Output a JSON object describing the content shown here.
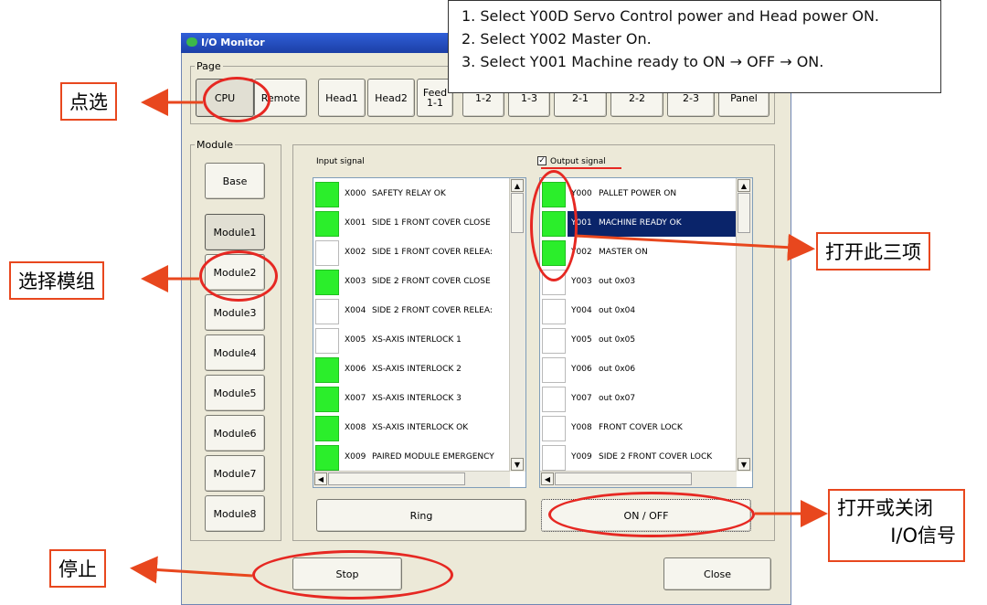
{
  "window": {
    "title": "I/O Monitor"
  },
  "page_group": {
    "label": "Page",
    "buttons": [
      "CPU",
      "Remote",
      "Head1",
      "Head2",
      "Feed\n1-1",
      "1-2",
      "1-3",
      "2-1",
      "2-2",
      "2-3",
      "Panel"
    ]
  },
  "module_group": {
    "label": "Module",
    "buttons": [
      "Base",
      "Module1",
      "Module2",
      "Module3",
      "Module4",
      "Module5",
      "Module6",
      "Module7",
      "Module8"
    ]
  },
  "input_panel": {
    "label": "Input signal",
    "rows": [
      {
        "code": "X000",
        "name": "SAFETY RELAY OK",
        "on": true
      },
      {
        "code": "X001",
        "name": "SIDE 1 FRONT COVER CLOSE",
        "on": true
      },
      {
        "code": "X002",
        "name": "SIDE 1 FRONT COVER RELEA:",
        "on": false
      },
      {
        "code": "X003",
        "name": "SIDE 2 FRONT COVER CLOSE",
        "on": true
      },
      {
        "code": "X004",
        "name": "SIDE 2 FRONT COVER RELEA:",
        "on": false
      },
      {
        "code": "X005",
        "name": "XS-AXIS INTERLOCK 1",
        "on": false
      },
      {
        "code": "X006",
        "name": "XS-AXIS INTERLOCK 2",
        "on": true
      },
      {
        "code": "X007",
        "name": "XS-AXIS INTERLOCK 3",
        "on": true
      },
      {
        "code": "X008",
        "name": "XS-AXIS INTERLOCK OK",
        "on": true
      },
      {
        "code": "X009",
        "name": "PAIRED MODULE EMERGENCY",
        "on": true
      }
    ]
  },
  "output_panel": {
    "label": "Output signal",
    "checked": true,
    "rows": [
      {
        "code": "Y000",
        "name": "PALLET POWER ON",
        "on": true
      },
      {
        "code": "Y001",
        "name": "MACHINE READY OK",
        "on": true,
        "selected": true
      },
      {
        "code": "Y002",
        "name": "MASTER ON",
        "on": true
      },
      {
        "code": "Y003",
        "name": "out 0x03",
        "on": false
      },
      {
        "code": "Y004",
        "name": "out 0x04",
        "on": false
      },
      {
        "code": "Y005",
        "name": "out 0x05",
        "on": false
      },
      {
        "code": "Y006",
        "name": "out 0x06",
        "on": false
      },
      {
        "code": "Y007",
        "name": "out 0x07",
        "on": false
      },
      {
        "code": "Y008",
        "name": "FRONT COVER LOCK",
        "on": false
      },
      {
        "code": "Y009",
        "name": "SIDE 2 FRONT COVER LOCK",
        "on": false
      }
    ]
  },
  "buttons": {
    "ring": "Ring",
    "onoff": "ON / OFF",
    "stop": "Stop",
    "close": "Close"
  },
  "instructions": [
    "1. Select Y00D Servo Control power and Head power ON.",
    "2. Select Y002 Master On.",
    "3. Select Y001 Machine ready to ON → OFF → ON."
  ],
  "callouts": {
    "click": "点选",
    "select_module": "选择模组",
    "open_three": "打开此三项",
    "toggle_io_line1": "打开或关闭",
    "toggle_io_line2": "I/O信号",
    "stop": "停止"
  },
  "colors": {
    "signal_on": "#2bee2b",
    "selection": "#0a246a",
    "annotation": "#e62822",
    "titlebar": "#2f5fd8"
  }
}
